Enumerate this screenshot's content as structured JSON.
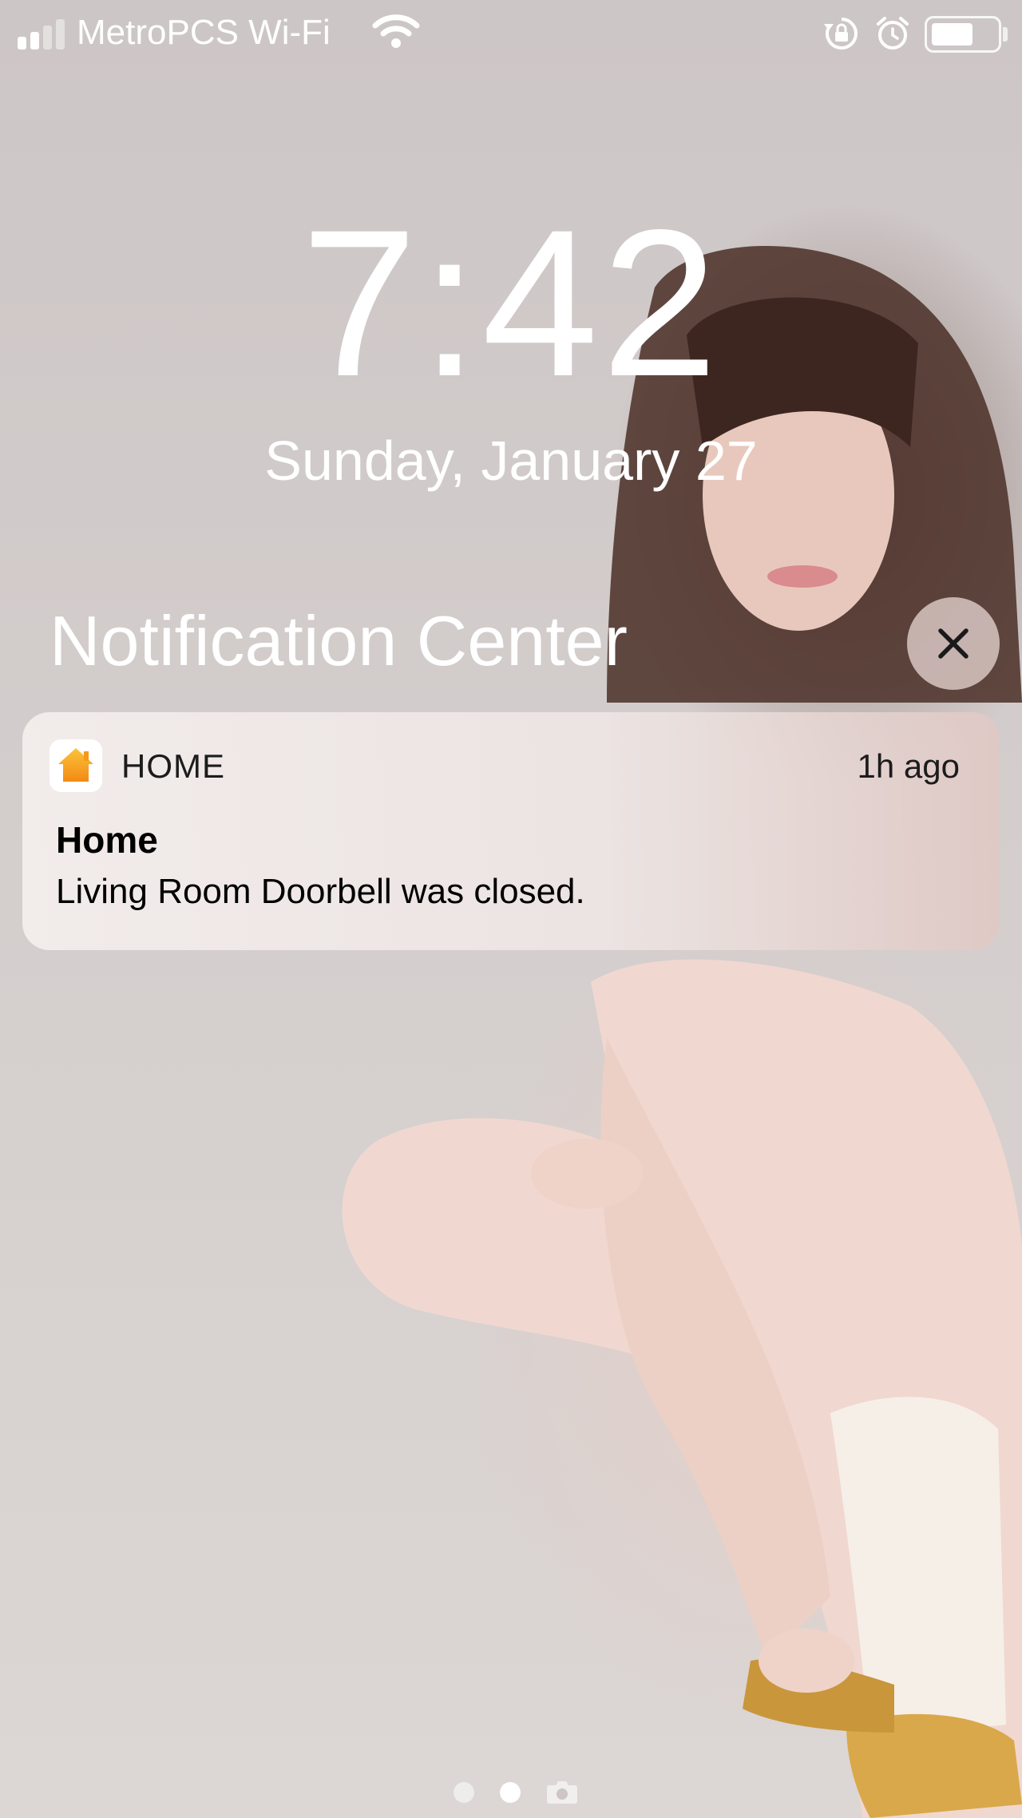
{
  "status_bar": {
    "carrier": "MetroPCS Wi-Fi",
    "signal_bars_filled": 2,
    "signal_bars_total": 4,
    "battery_level": 0.65,
    "icons": [
      "signal-icon",
      "wifi-icon",
      "rotation-lock-icon",
      "alarm-icon",
      "battery-icon"
    ]
  },
  "lock_screen": {
    "time": "7:42",
    "date": "Sunday, January 27"
  },
  "notification_center": {
    "title": "Notification Center",
    "close_icon": "close-icon"
  },
  "notifications": [
    {
      "app_icon": "home-app-icon",
      "app_name": "HOME",
      "time": "1h ago",
      "title": "Home",
      "body": "Living Room Doorbell was closed."
    }
  ],
  "page_indicator": {
    "pages": 3,
    "active_index": 1,
    "last_page_icon": "camera-icon"
  },
  "colors": {
    "text_on_wallpaper": "#ffffff",
    "home_icon_orange": "#f5a020",
    "notification_text": "#000000"
  }
}
